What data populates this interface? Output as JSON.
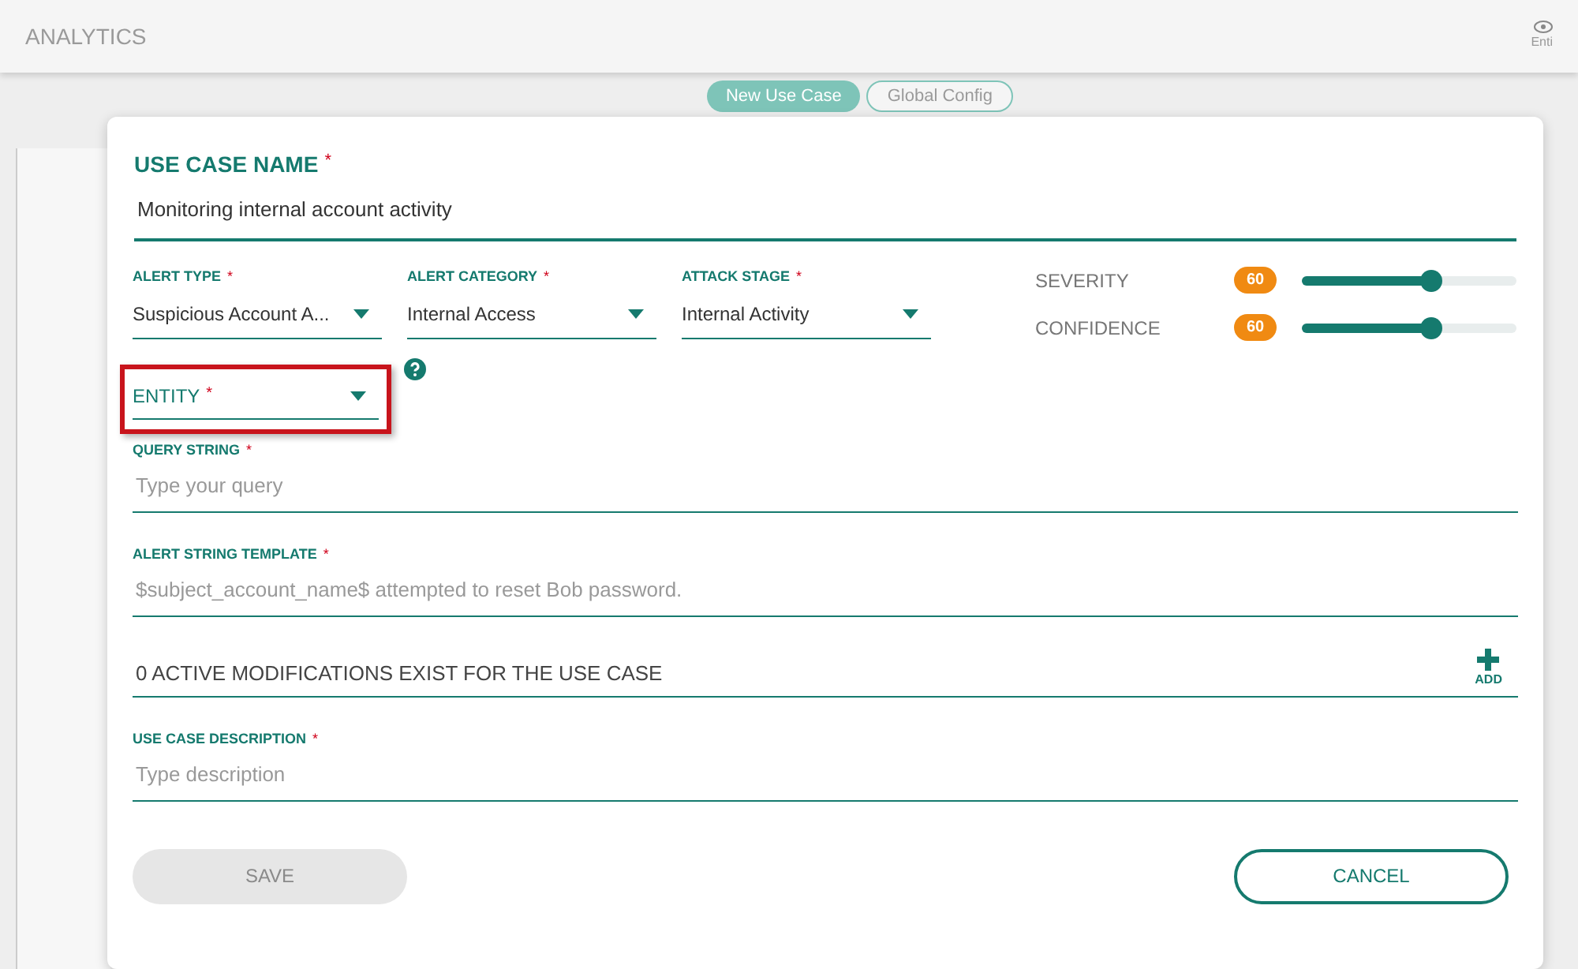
{
  "header": {
    "title": "ANALYTICS",
    "right_label": "Enti"
  },
  "tabs": [
    {
      "label": "New Use Case",
      "selected": true
    },
    {
      "label": "Global Config",
      "selected": false
    }
  ],
  "form": {
    "name": {
      "label": "USE CASE NAME",
      "required_mark": "*",
      "value": "Monitoring internal account activity"
    },
    "selects": [
      {
        "label": "ALERT TYPE",
        "required_mark": "*",
        "value": "Suspicious Account A..."
      },
      {
        "label": "ALERT CATEGORY",
        "required_mark": "*",
        "value": "Internal Access"
      },
      {
        "label": "ATTACK STAGE",
        "required_mark": "*",
        "value": "Internal Activity"
      }
    ],
    "sliders": [
      {
        "label": "SEVERITY",
        "reading": "60",
        "level": 0.6
      },
      {
        "label": "CONFIDENCE",
        "reading": "60",
        "level": 0.6
      }
    ],
    "entity": {
      "label": "ENTITY",
      "required_mark": "*",
      "highlighted": true
    },
    "query": {
      "label": "QUERY STRING",
      "required_mark": "*",
      "placeholder": "Type your query"
    },
    "template": {
      "label": "ALERT STRING TEMPLATE",
      "required_mark": "*",
      "placeholder": "$subject_account_name$ attempted to reset Bob password."
    },
    "modifications": {
      "text": "0 ACTIVE MODIFICATIONS EXIST FOR THE USE CASE",
      "add_label": "ADD"
    },
    "description": {
      "label": "USE CASE DESCRIPTION",
      "required_mark": "*",
      "placeholder": "Type description"
    },
    "save": {
      "label": "SAVE",
      "disabled": true
    },
    "cancel": {
      "label": "CANCEL"
    }
  }
}
